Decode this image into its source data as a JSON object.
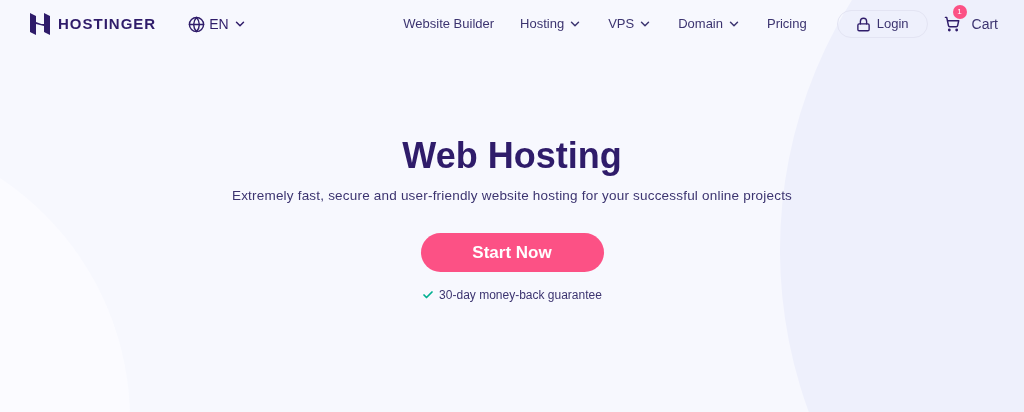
{
  "header": {
    "brand": "HOSTINGER",
    "language": "EN",
    "nav": [
      {
        "label": "Website Builder",
        "has_menu": false
      },
      {
        "label": "Hosting",
        "has_menu": true
      },
      {
        "label": "VPS",
        "has_menu": true
      },
      {
        "label": "Domain",
        "has_menu": true
      },
      {
        "label": "Pricing",
        "has_menu": false
      }
    ],
    "login": "Login",
    "cart": {
      "label": "Cart",
      "badge": "1"
    }
  },
  "hero": {
    "title": "Web Hosting",
    "subtitle": "Extremely fast, secure and user-friendly website hosting for your successful online projects",
    "cta": "Start Now",
    "guarantee": "30-day money-back guarantee"
  }
}
